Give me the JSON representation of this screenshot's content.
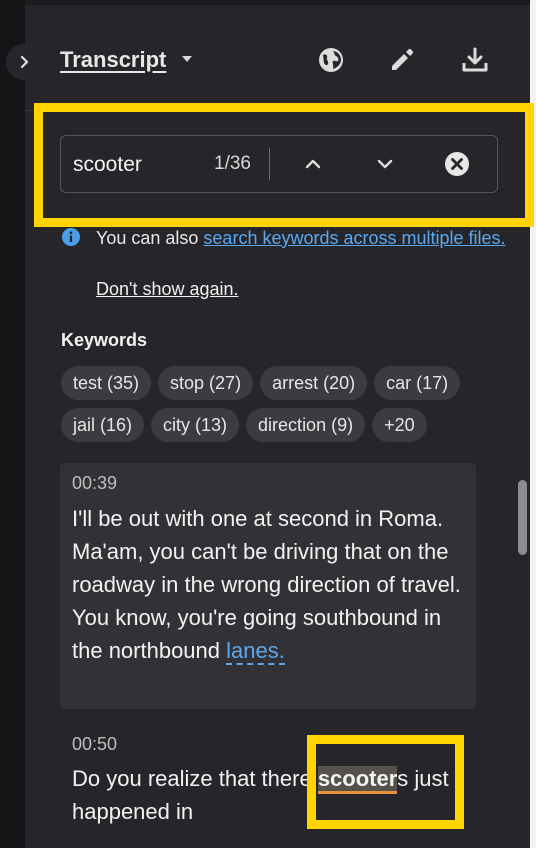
{
  "header": {
    "title": "Transcript"
  },
  "search": {
    "value": "scooter",
    "match_count": "1/36"
  },
  "info": {
    "prefix": "You can also ",
    "link": "search keywords across multiple files.",
    "dismiss": "Don't show again."
  },
  "keywords": {
    "title": "Keywords",
    "row1": [
      "test (35)",
      "stop (27)",
      "arrest (20)",
      "car (17)"
    ],
    "row2": [
      "jail (16)",
      "city (13)",
      "direction (9)",
      "+20"
    ]
  },
  "segments": [
    {
      "time": "00:39",
      "text": "I'll be out with one at second in Roma. Ma'am, you can't be driving that on the roadway in the wrong direction of travel. You know, you're going southbound in the northbound ",
      "link": "lanes."
    },
    {
      "time": "00:50",
      "pre": "Do you realize that there ",
      "hit": "scooter",
      "post": "s just happened in"
    }
  ],
  "colors": {
    "accent_link": "#5aa9f0",
    "highlight_frame": "#ffd400",
    "match_underline": "#e79436"
  },
  "icons": {
    "collapse": "chevron-right-icon",
    "language": "globe-icon",
    "edit": "pencil-icon",
    "download": "download-icon",
    "prev": "chevron-up-icon",
    "next": "chevron-down-icon",
    "clear": "close-circle-icon",
    "info": "info-icon"
  }
}
